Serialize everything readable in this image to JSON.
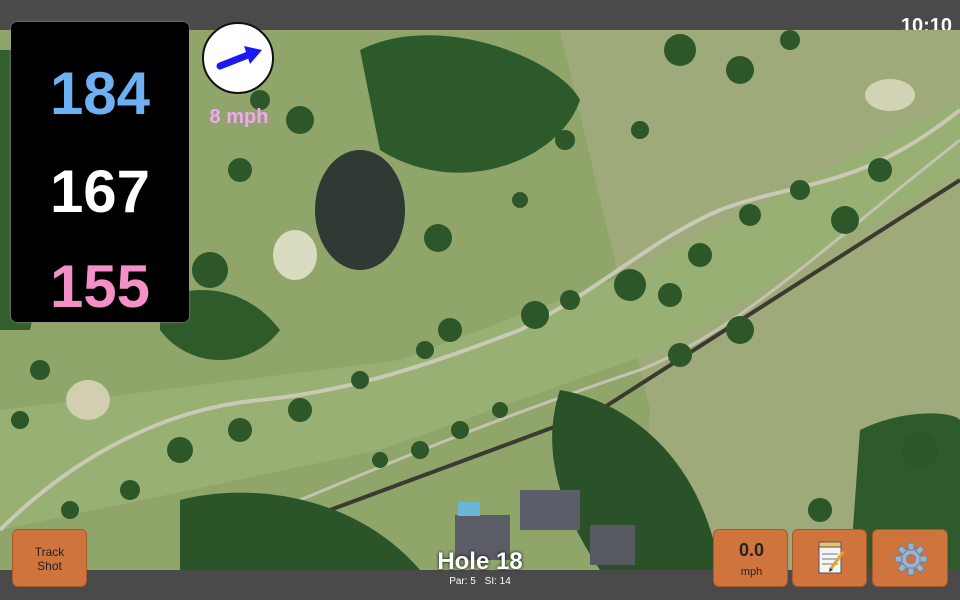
{
  "status_bar": {
    "time": "10:10"
  },
  "yardages": {
    "back": "184",
    "middle": "167",
    "front": "155",
    "back_color": "#6fb0f3",
    "middle_color": "#ffffff",
    "front_color": "#f48fc8"
  },
  "wind": {
    "label": "8 mph",
    "icon": "wind-direction-arrow-icon",
    "arrow_color": "#1a1af0"
  },
  "buttons": {
    "track_shot_line1": "Track",
    "track_shot_line2": "Shot",
    "speed_value": "0.0",
    "speed_unit": "mph",
    "notes_icon": "notepad-icon",
    "settings_icon": "gear-icon",
    "accent": "#d0743d"
  },
  "hole": {
    "title": "Hole 18",
    "par": "Par: 5",
    "stroke_index": "SI: 14"
  }
}
